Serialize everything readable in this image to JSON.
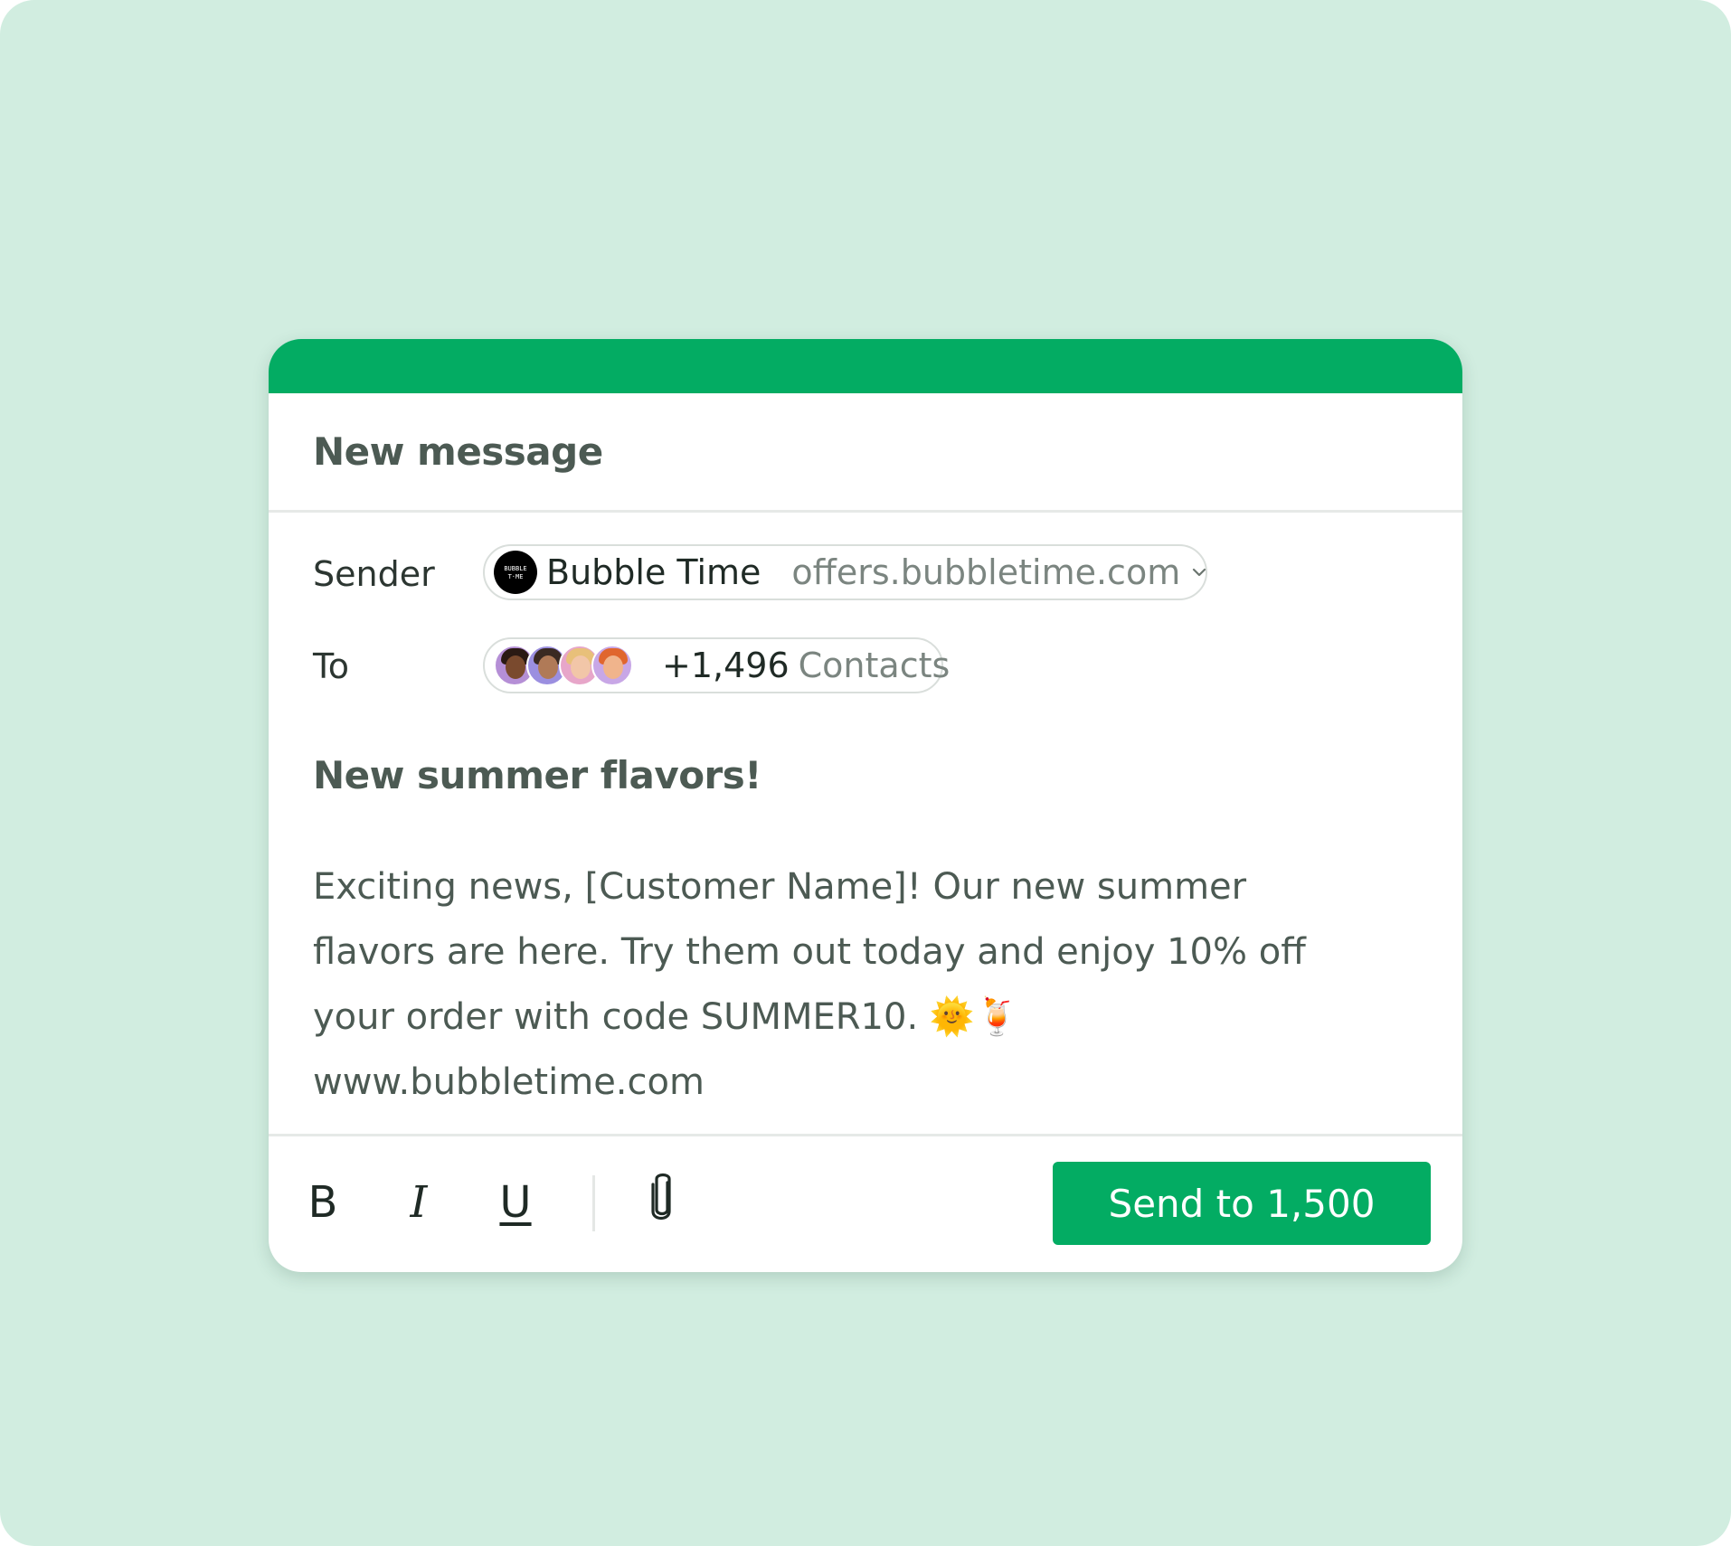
{
  "header": {
    "title": "New message"
  },
  "sender": {
    "label": "Sender",
    "logo_text_top": "BUBBLE",
    "logo_text_bottom": "T·ME",
    "name": "Bubble Time",
    "domain": "offers.bubbletime.com"
  },
  "to": {
    "label": "To",
    "count": "+1,496",
    "contacts_label": "Contacts"
  },
  "message": {
    "subject": "New summer flavors!",
    "body": "Exciting news, [Customer Name]! Our new summer flavors are here. Try them out today and enjoy 10% off your order with code SUMMER10. 🌞🍹 www.bubbletime.com"
  },
  "toolbar": {
    "bold_label": "B",
    "italic_label": "I",
    "underline_label": "U",
    "send_label": "Send to 1,500"
  },
  "colors": {
    "accent": "#03ac63",
    "background": "#d1ede0"
  }
}
